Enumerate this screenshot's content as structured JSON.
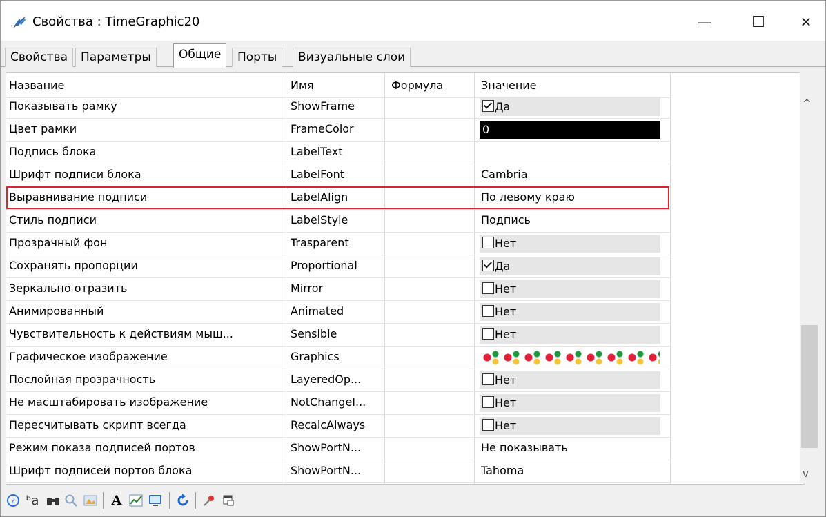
{
  "window": {
    "title": "Свойства : TimeGraphic20",
    "minimize_glyph": "—",
    "maximize_glyph": "☐",
    "close_glyph": "✕"
  },
  "tabs": [
    {
      "label": "Свойства",
      "active": false
    },
    {
      "label": "Параметры",
      "active": false
    },
    {
      "label": "Общие",
      "active": true
    },
    {
      "label": "Порты",
      "active": false
    },
    {
      "label": "Визуальные слои",
      "active": false
    }
  ],
  "grid": {
    "headers": [
      "Название",
      "Имя",
      "Формула",
      "Значение"
    ],
    "rows": [
      {
        "name": "Показывать рамку",
        "id": "ShowFrame",
        "formula": "",
        "value": "Да",
        "checkbox": true,
        "checked": true
      },
      {
        "name": "Цвет рамки",
        "id": "FrameColor",
        "formula": "",
        "value": "0",
        "color_swatch": "#000000"
      },
      {
        "name": "Подпись блока",
        "id": "LabelText",
        "formula": "",
        "value": ""
      },
      {
        "name": "Шрифт подписи блока",
        "id": "LabelFont",
        "formula": "",
        "value": "Cambria"
      },
      {
        "name": "Выравнивание подписи",
        "id": "LabelAlign",
        "formula": "",
        "value": "По левому краю",
        "highlighted": true
      },
      {
        "name": "Стиль подписи",
        "id": "LabelStyle",
        "formula": "",
        "value": "Подпись"
      },
      {
        "name": "Прозрачный фон",
        "id": "Trasparent",
        "formula": "",
        "value": "Нет",
        "checkbox": true,
        "checked": false
      },
      {
        "name": "Сохранять пропорции",
        "id": "Proportional",
        "formula": "",
        "value": "Да",
        "checkbox": true,
        "checked": true
      },
      {
        "name": "Зеркально отразить",
        "id": "Mirror",
        "formula": "",
        "value": "Нет",
        "checkbox": true,
        "checked": false
      },
      {
        "name": "Анимированный",
        "id": "Animated",
        "formula": "",
        "value": "Нет",
        "checkbox": true,
        "checked": false
      },
      {
        "name": "Чувствительность к действиям мыш...",
        "id": "Sensible",
        "formula": "",
        "value": "Нет",
        "checkbox": true,
        "checked": false
      },
      {
        "name": "Графическое изображение",
        "id": "Graphics",
        "formula": "",
        "value": "",
        "image_pattern": true
      },
      {
        "name": "Послойная прозрачность",
        "id": "LayeredOp...",
        "formula": "",
        "value": "Нет",
        "checkbox": true,
        "checked": false
      },
      {
        "name": "Не масштабировать изображение",
        "id": "NotChangeI...",
        "formula": "",
        "value": "Нет",
        "checkbox": true,
        "checked": false
      },
      {
        "name": "Пересчитывать скрипт всегда",
        "id": "RecalcAlways",
        "formula": "",
        "value": "Нет",
        "checkbox": true,
        "checked": false
      },
      {
        "name": "Режим показа подписей портов",
        "id": "ShowPortN...",
        "formula": "",
        "value": "Не показывать"
      },
      {
        "name": "Шрифт подписей портов блока",
        "id": "ShowPortN...",
        "formula": "",
        "value": "Tahoma"
      }
    ]
  },
  "scrollbar": {
    "up_glyph": "^",
    "down_glyph": "v"
  },
  "toolbar": {
    "icons": [
      "help-icon",
      "rename-icon",
      "find-icon",
      "zoom-icon",
      "picture-icon",
      "font-icon",
      "chart-icon",
      "monitor-icon",
      "refresh-icon",
      "pin-icon",
      "window-icon"
    ],
    "font_glyph": "A",
    "rename_glyph": "ᵇa"
  },
  "colors": {
    "highlight_border": "#d8262e",
    "value_bg": "#e6e6e6"
  }
}
